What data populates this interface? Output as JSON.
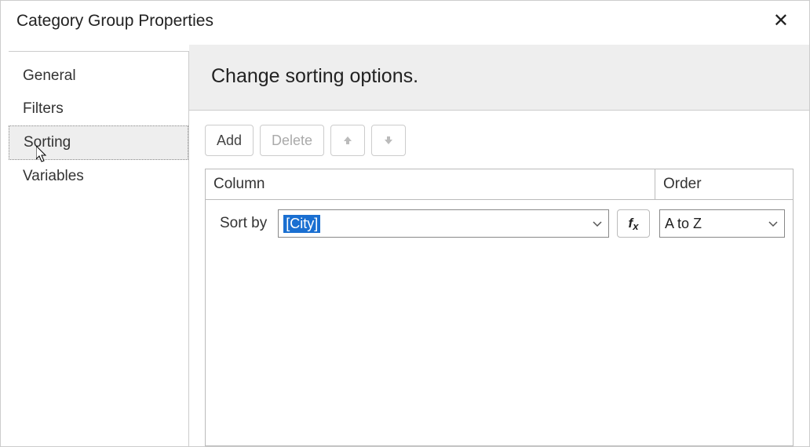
{
  "dialog": {
    "title": "Category Group Properties"
  },
  "sidebar": {
    "items": [
      {
        "label": "General"
      },
      {
        "label": "Filters"
      },
      {
        "label": "Sorting"
      },
      {
        "label": "Variables"
      }
    ]
  },
  "panel": {
    "header": "Change sorting options."
  },
  "toolbar": {
    "add": "Add",
    "delete": "Delete"
  },
  "grid": {
    "column_header": "Column",
    "order_header": "Order",
    "sort_by_label": "Sort by",
    "column_value": "[City]",
    "order_value": "A to Z"
  },
  "icons": {
    "close": "✕"
  }
}
